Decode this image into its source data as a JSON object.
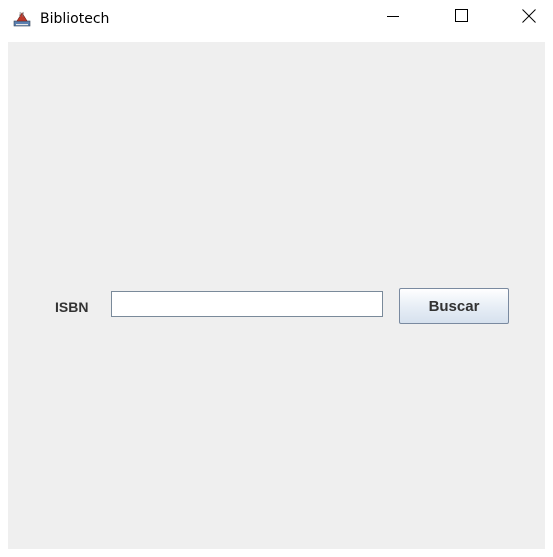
{
  "window": {
    "title": "Bibliotech",
    "icon": "java-coffee-icon",
    "controls": {
      "minimize_icon": "minimize-icon",
      "maximize_icon": "maximize-icon",
      "close_icon": "close-icon"
    }
  },
  "form": {
    "isbn_label": "ISBN",
    "isbn_value": "",
    "search_label": "Buscar"
  },
  "colors": {
    "content_background": "#efefef",
    "titlebar_background": "#ffffff",
    "label_text": "#333333",
    "button_border": "#7a8aa0"
  }
}
